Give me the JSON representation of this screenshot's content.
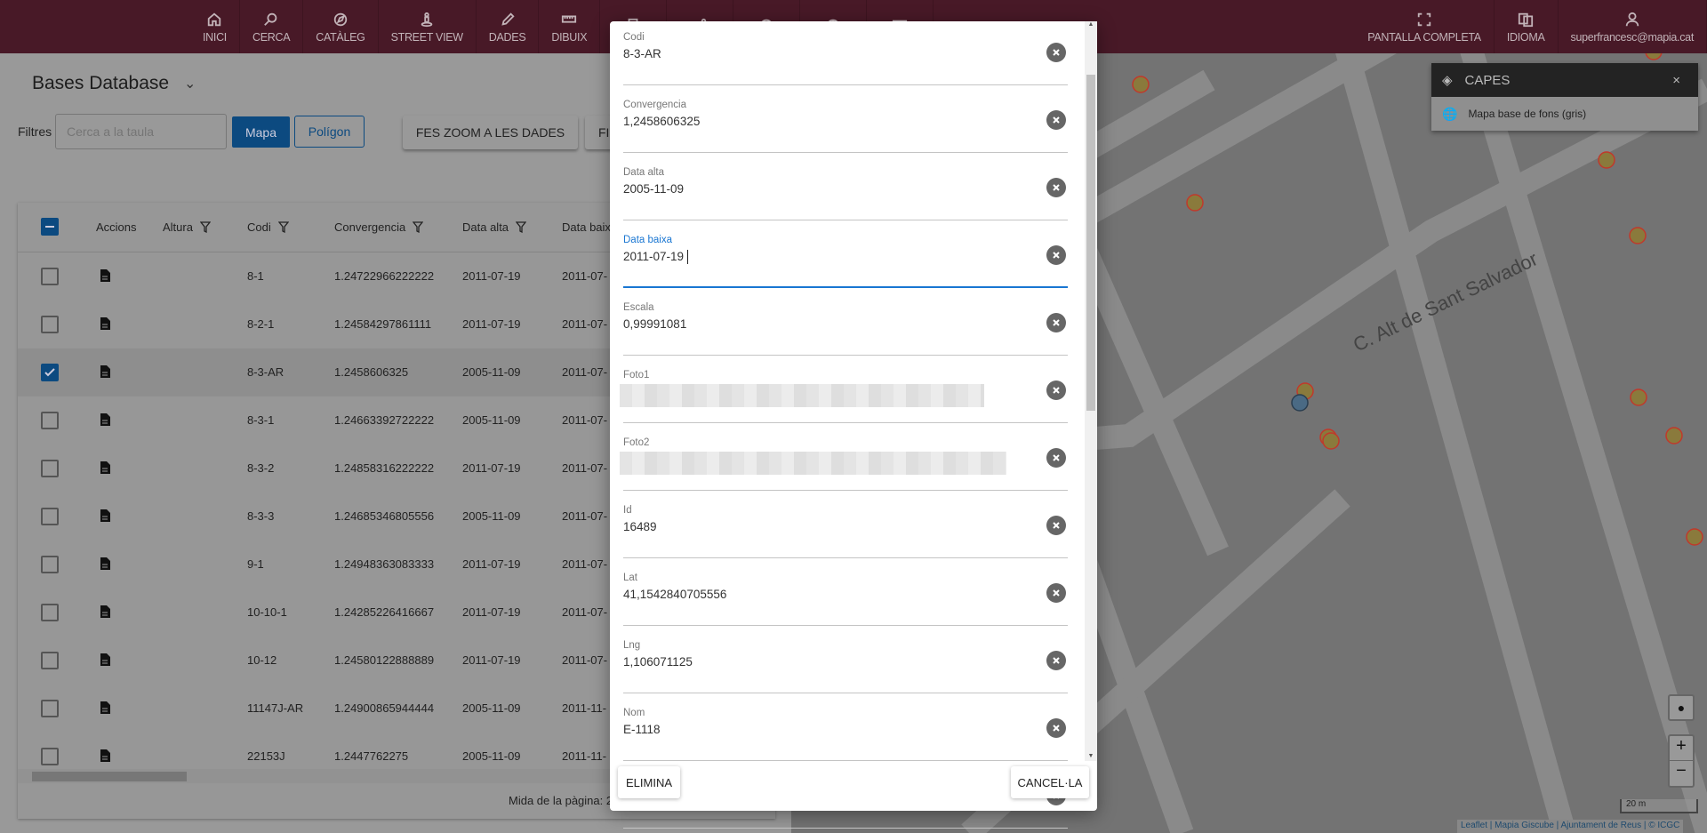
{
  "topbar": {
    "nav_left": [
      {
        "label": "INICI",
        "icon": "home-icon"
      },
      {
        "label": "CERCA",
        "icon": "search-icon"
      },
      {
        "label": "CATÀLEG",
        "icon": "compass-icon"
      },
      {
        "label": "STREET VIEW",
        "icon": "pegman-icon"
      },
      {
        "label": "DADES",
        "icon": "pencil-icon"
      },
      {
        "label": "DIBUIX",
        "icon": "ruler-icon"
      }
    ],
    "nav_hidden_icons": [
      "print-icon",
      "share-icon",
      "clock-icon",
      "pie-chart-icon",
      "mail-icon"
    ],
    "nav_right": [
      {
        "label": "PANTALLA COMPLETA",
        "icon": "fullscreen-icon"
      },
      {
        "label": "IDIOMA",
        "icon": "translate-icon"
      },
      {
        "label": "superfrancesc@mapia.cat",
        "icon": "user-icon"
      }
    ]
  },
  "panel": {
    "title": "Bases Database",
    "filters_label": "Filtres",
    "search_placeholder": "Cerca a la taula",
    "btn_mapa": "Mapa",
    "btn_poligon": "Polígon",
    "btn_zoom": "FES ZOOM A LES DADES",
    "btn_f": "FI",
    "page_size_label": "Mida de la pàgina:  2"
  },
  "table": {
    "columns": [
      "Accions",
      "Altura",
      "Codi",
      "Convergencia",
      "Data alta",
      "Data baixa"
    ],
    "rows": [
      {
        "selected": false,
        "codi": "8-1",
        "conv": "1.24722966222222",
        "alta": "2011-07-19",
        "baixa": "2011-07-"
      },
      {
        "selected": false,
        "codi": "8-2-1",
        "conv": "1.24584297861111",
        "alta": "2011-07-19",
        "baixa": "2011-07-"
      },
      {
        "selected": true,
        "codi": "8-3-AR",
        "conv": "1.2458606325",
        "alta": "2005-11-09",
        "baixa": "2011-07-"
      },
      {
        "selected": false,
        "codi": "8-3-1",
        "conv": "1.24663392722222",
        "alta": "2005-11-09",
        "baixa": "2011-07-"
      },
      {
        "selected": false,
        "codi": "8-3-2",
        "conv": "1.24858316222222",
        "alta": "2011-07-19",
        "baixa": "2011-07-"
      },
      {
        "selected": false,
        "codi": "8-3-3",
        "conv": "1.24685346805556",
        "alta": "2005-11-09",
        "baixa": "2011-07-"
      },
      {
        "selected": false,
        "codi": "9-1",
        "conv": "1.24948363083333",
        "alta": "2011-07-19",
        "baixa": "2011-07-"
      },
      {
        "selected": false,
        "codi": "10-10-1",
        "conv": "1.24285226416667",
        "alta": "2011-07-19",
        "baixa": "2011-07-"
      },
      {
        "selected": false,
        "codi": "10-12",
        "conv": "1.24580122888889",
        "alta": "2011-07-19",
        "baixa": "2011-07-"
      },
      {
        "selected": false,
        "codi": "11147J-AR",
        "conv": "1.24900865944444",
        "alta": "2005-11-09",
        "baixa": "2011-11-"
      },
      {
        "selected": false,
        "codi": "22153J",
        "conv": "1.2447762275",
        "alta": "2005-11-09",
        "baixa": "2011-11-"
      }
    ]
  },
  "modal": {
    "fields": [
      {
        "label": "Codi",
        "value": "8-3-AR"
      },
      {
        "label": "Convergencia",
        "value": "1,2458606325"
      },
      {
        "label": "Data alta",
        "value": "2005-11-09"
      },
      {
        "label": "Data baixa",
        "value": "2011-07-19",
        "focused": true
      },
      {
        "label": "Escala",
        "value": "0,99991081"
      },
      {
        "label": "Foto1",
        "value": "",
        "redacted": true
      },
      {
        "label": "Foto2",
        "value": "",
        "redacted": true
      },
      {
        "label": "Id",
        "value": "16489"
      },
      {
        "label": "Lat",
        "value": "41,1542840705556"
      },
      {
        "label": "Lng",
        "value": "1,106071125"
      },
      {
        "label": "Nom",
        "value": "E-1118"
      },
      {
        "label": "",
        "value": ""
      }
    ],
    "btn_delete": "ELIMINA",
    "btn_cancel": "CANCEL·LA"
  },
  "map": {
    "street_label": "C. Alt de Sant Salvador",
    "layers_title": "CAPES",
    "layers_close": "×",
    "layer_item": "Mapa base de fons (gris)",
    "zoom_in": "+",
    "zoom_out": "−",
    "scale": "20 m",
    "attribution": "Leaflet | Mapia Giscube | Ajuntament de Reus | © ICGC"
  }
}
